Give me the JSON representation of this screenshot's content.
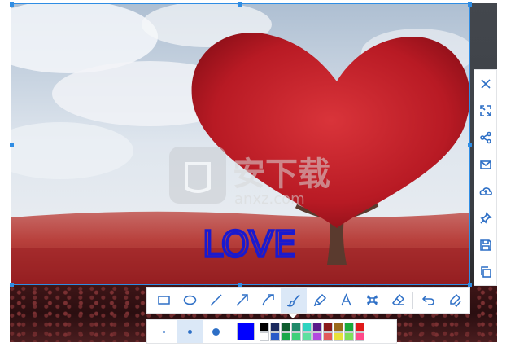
{
  "screenshot": {
    "annotation_text": "LOVE",
    "annotation_color": "#1a1acf",
    "watermark": {
      "cn": "安下载",
      "en": "anxz.com"
    }
  },
  "right_toolbar": {
    "items": [
      {
        "name": "close-icon"
      },
      {
        "name": "fullscreen-icon"
      },
      {
        "name": "share-icon"
      },
      {
        "name": "mail-icon"
      },
      {
        "name": "cloud-upload-icon"
      },
      {
        "name": "pin-icon"
      },
      {
        "name": "save-icon"
      },
      {
        "name": "copy-icon"
      }
    ]
  },
  "draw_toolbar": {
    "active": "brush-icon",
    "items": [
      {
        "name": "rectangle-icon"
      },
      {
        "name": "ellipse-icon"
      },
      {
        "name": "line-icon"
      },
      {
        "name": "arrow-icon"
      },
      {
        "name": "curved-arrow-icon"
      },
      {
        "name": "brush-icon"
      },
      {
        "name": "highlighter-icon"
      },
      {
        "name": "text-icon"
      },
      {
        "name": "mosaic-icon"
      },
      {
        "name": "eraser-icon"
      },
      {
        "name": "undo-icon"
      },
      {
        "name": "done-icon"
      }
    ]
  },
  "brush_options": {
    "sizes": [
      "small",
      "medium",
      "large"
    ],
    "active_size": "medium",
    "current_color": "#0000ff",
    "palette": [
      "#000000",
      "#1a2a5e",
      "#0e5c2e",
      "#1f8a6a",
      "#2fd3c0",
      "#5a1a8a",
      "#8a1a1a",
      "#9a6a1a",
      "#1aaa3a",
      "#e01a1a",
      "#ffffff",
      "#2a5ac8",
      "#1aa84a",
      "#3fd07a",
      "#5fe0a0",
      "#b24adf",
      "#e25a5a",
      "#e8e03a",
      "#7fe05a",
      "#ff4a8a"
    ]
  }
}
